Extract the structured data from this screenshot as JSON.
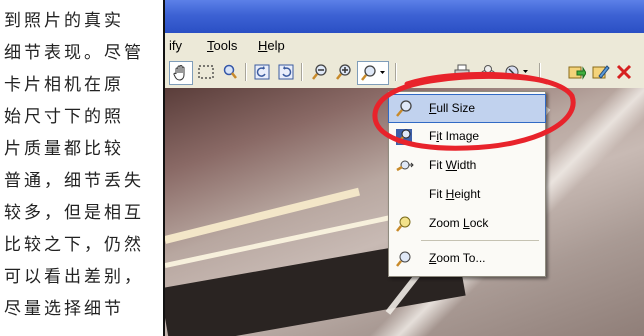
{
  "article": {
    "lines": [
      "到照片的真实",
      "细节表现。尽管",
      "卡片相机在原",
      "始尺寸下的照",
      "片质量都比较",
      "普通，细节丢失",
      "较多，但是相互",
      "比较之下，仍然",
      "可以看出差别，",
      "尽量选择细节"
    ]
  },
  "menubar": {
    "items": [
      {
        "label": "ify",
        "underline": ""
      },
      {
        "label": "Tools",
        "underline": "T"
      },
      {
        "label": "Help",
        "underline": "H"
      }
    ]
  },
  "toolbar": {
    "icons": [
      "hand-icon",
      "marquee-select-icon",
      "lasso-icon",
      "rotate-left-icon",
      "rotate-right-icon",
      "zoom-out-icon",
      "zoom-in-icon",
      "zoom-dropdown-icon",
      "print-icon",
      "scan-icon",
      "filter-icon",
      "export-icon",
      "edit-icon",
      "delete-icon"
    ]
  },
  "dropdown": {
    "items": [
      {
        "label": "Full Size",
        "icon": "zoom-full-size-icon",
        "selected": true
      },
      {
        "label": "Fit Image",
        "icon": "zoom-fit-image-icon",
        "selected": false
      },
      {
        "label": "Fit Width",
        "icon": "zoom-fit-width-icon",
        "selected": false
      },
      {
        "label": "Fit Height",
        "icon": "",
        "selected": false
      },
      {
        "label": "Zoom Lock",
        "icon": "zoom-lock-icon",
        "selected": false
      },
      {
        "label": "Zoom To...",
        "icon": "zoom-to-icon",
        "selected": false
      }
    ]
  },
  "colors": {
    "titlebar": "#3d62d4",
    "menu_bg": "#ece9d8",
    "selection": "#c1d2ee",
    "annotation": "#e8232b"
  }
}
